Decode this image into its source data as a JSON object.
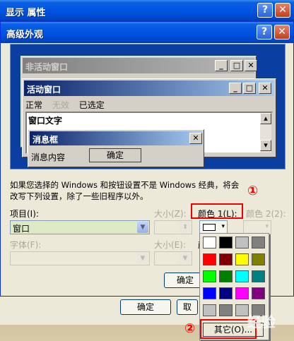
{
  "display_props": {
    "title": "显示 属性",
    "help": "?",
    "close": "✕"
  },
  "advanced": {
    "title": "高级外观",
    "help": "?",
    "close": "✕",
    "preview": {
      "inactive_title": "非活动窗口",
      "active_title": "活动窗口",
      "menu": [
        "正常",
        "无效",
        "已选定"
      ],
      "window_text": "窗口文字",
      "msgbox_title": "消息框",
      "msgbox_text": "消息内容",
      "msgbox_ok": "确定"
    },
    "description": "如果您选择的 Windows 和按钮设置不是 Windows 经典，将会改写下列设置，除了一些旧程序以外。",
    "item_label": "项目(I):",
    "item_value": "窗口",
    "size1_label": "大小(Z):",
    "color1_label": "颜色 1(L):",
    "color2_label": "颜色 2(2):",
    "font_label": "字体(F):",
    "size2_label": "大小(E):",
    "color3_label": "颜",
    "ok": "确定",
    "cancel": "取"
  },
  "main_buttons": {
    "ok": "确定",
    "cancel": "取"
  },
  "palette": {
    "colors": [
      "#ffffff",
      "#000000",
      "#c0c0c0",
      "#808080",
      "#ff0000",
      "#800000",
      "#ffff00",
      "#808000",
      "#00ff00",
      "#008000",
      "#00ffff",
      "#008080",
      "#0000ff",
      "#000080",
      "#ff00ff",
      "#800080",
      "#c0c0c0",
      "#808080",
      "#c0c0c0",
      "#808080"
    ],
    "other": "其它(O)..."
  },
  "annotations": {
    "step1": "①",
    "step2": "②"
  },
  "watermark": "经验"
}
